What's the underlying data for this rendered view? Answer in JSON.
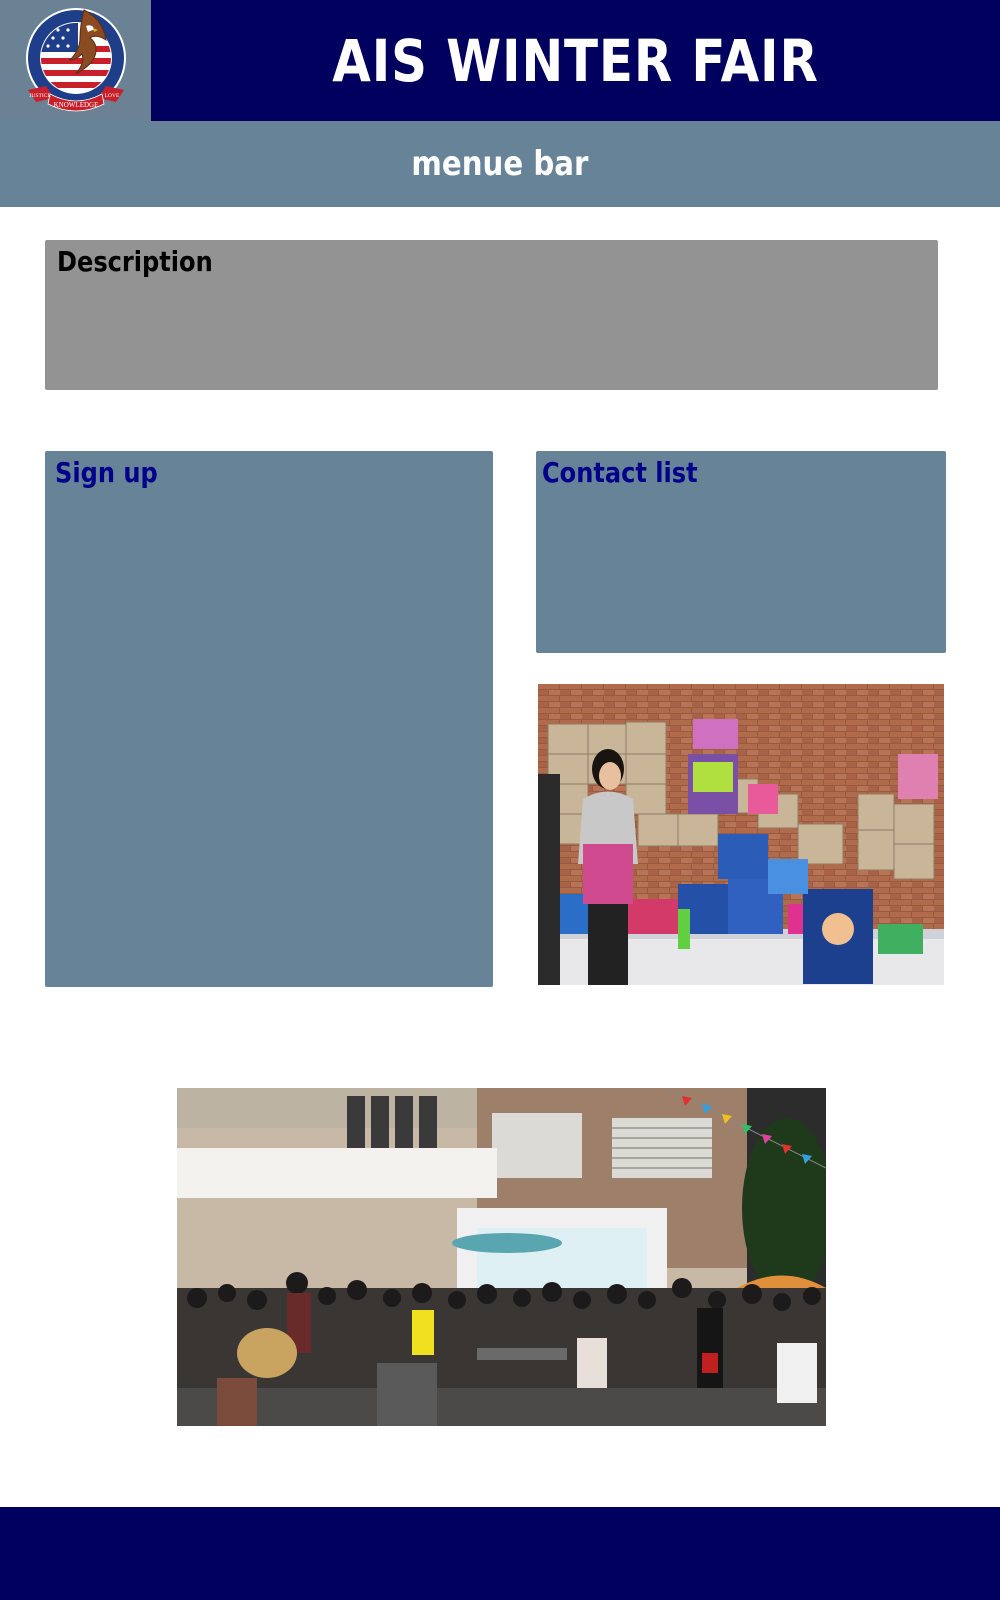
{
  "header": {
    "title": "AIS WINTER FAIR",
    "logo": {
      "icon": "school-eagle-logo-icon",
      "text_left": "JUSTICE",
      "text_bottom": "KNOWLEDGE",
      "text_right": "LOVE",
      "ring_text": "AMERICAN INTERNATIONAL SCHOOL"
    }
  },
  "menubar": {
    "label": "menue bar"
  },
  "description": {
    "title": "Description"
  },
  "signup": {
    "title": "Sign up"
  },
  "contact": {
    "title": "Contact list"
  },
  "colors": {
    "header_bg": "#00005f",
    "menubar_bg": "#678398",
    "panel_bg": "#678398",
    "description_bg": "#939393",
    "panel_title": "#00008a",
    "footer_bg": "#00005f"
  }
}
